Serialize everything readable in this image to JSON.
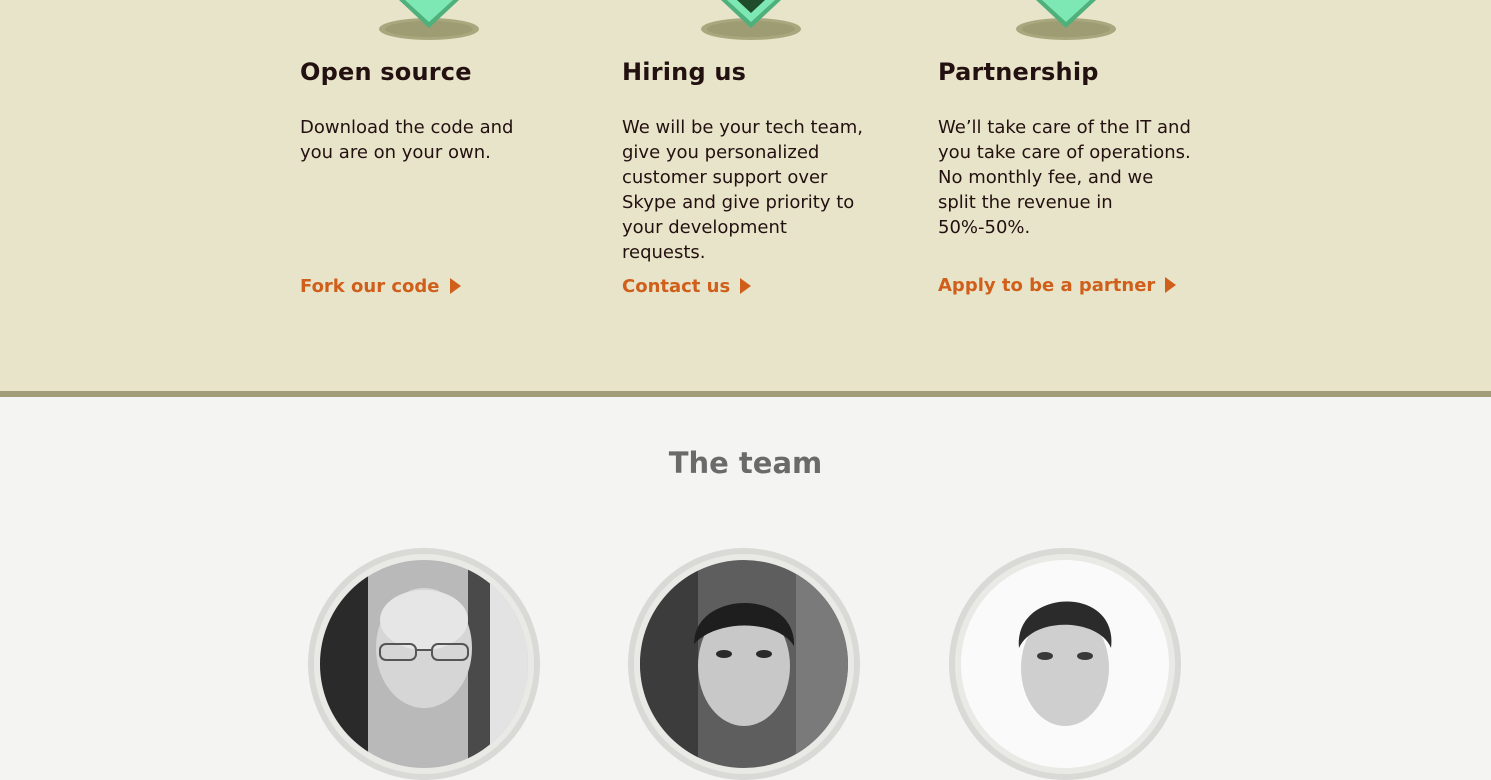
{
  "offers": {
    "columns": [
      {
        "key": "open-source",
        "title": "Open source",
        "text": "Download the code and you are on your own.",
        "link": "Fork our code",
        "icon": "diamond-badge-icon",
        "icon_variant": "plain"
      },
      {
        "key": "hiring",
        "title": "Hiring us",
        "text": "We will be your tech team, give you personalized customer support over Skype and give priority to your development requests.",
        "link": "Contact us",
        "icon": "diamond-badge-icon",
        "icon_variant": "dark-center"
      },
      {
        "key": "partnership",
        "title": "Partnership",
        "text": "We’ll take care of the IT and you take care of operations. No monthly fee, and we split the revenue in 50%-50%.",
        "link": "Apply to be a partner",
        "icon": "diamond-badge-icon",
        "icon_variant": "plain"
      }
    ]
  },
  "team": {
    "title": "The team",
    "members": [
      {
        "photo": "portrait-bald-glasses"
      },
      {
        "photo": "portrait-dark-hair-outdoor"
      },
      {
        "photo": "portrait-dark-hair-white-bg"
      }
    ]
  },
  "colors": {
    "offers_bg": "#e8e4c9",
    "offers_border": "#a09d78",
    "team_bg": "#f4f4f3",
    "heading": "#231010",
    "link": "#cf5f1a",
    "team_heading": "#6a6a6a",
    "icon_green": "#7ee8b5"
  }
}
